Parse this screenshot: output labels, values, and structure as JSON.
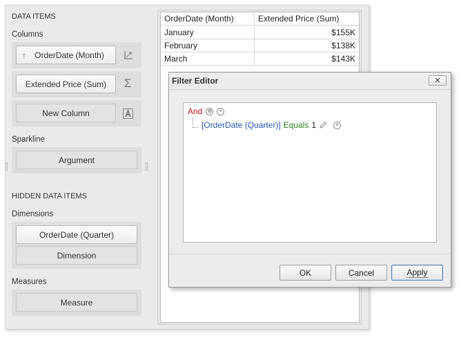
{
  "left_panel": {
    "data_items_title": "DATA ITEMS",
    "columns_label": "Columns",
    "columns": [
      {
        "label": "OrderDate (Month)",
        "icon": "sort-up-arrow-icon"
      },
      {
        "label": "Extended Price (Sum)",
        "icon": "sigma-icon"
      },
      {
        "label": "New Column",
        "icon": "text-column-icon"
      }
    ],
    "sparkline_label": "Sparkline",
    "sparkline_button": "Argument",
    "hidden_title": "HIDDEN DATA ITEMS",
    "dimensions_label": "Dimensions",
    "dimensions": [
      "OrderDate (Quarter)",
      "Dimension"
    ],
    "measures_label": "Measures",
    "measures": [
      "Measure"
    ]
  },
  "grid": {
    "headers": [
      "OrderDate (Month)",
      "Extended Price (Sum)"
    ],
    "rows": [
      [
        "January",
        "$155K"
      ],
      [
        "February",
        "$138K"
      ],
      [
        "March",
        "$143K"
      ]
    ]
  },
  "filter_editor": {
    "title": "Filter Editor",
    "close_label": "✕",
    "group_operator": "And",
    "condition": {
      "field": "[OrderDate (Quarter)]",
      "operator": "Equals",
      "value": "1"
    },
    "buttons": {
      "ok": "OK",
      "cancel": "Cancel",
      "apply": "Apply"
    }
  }
}
